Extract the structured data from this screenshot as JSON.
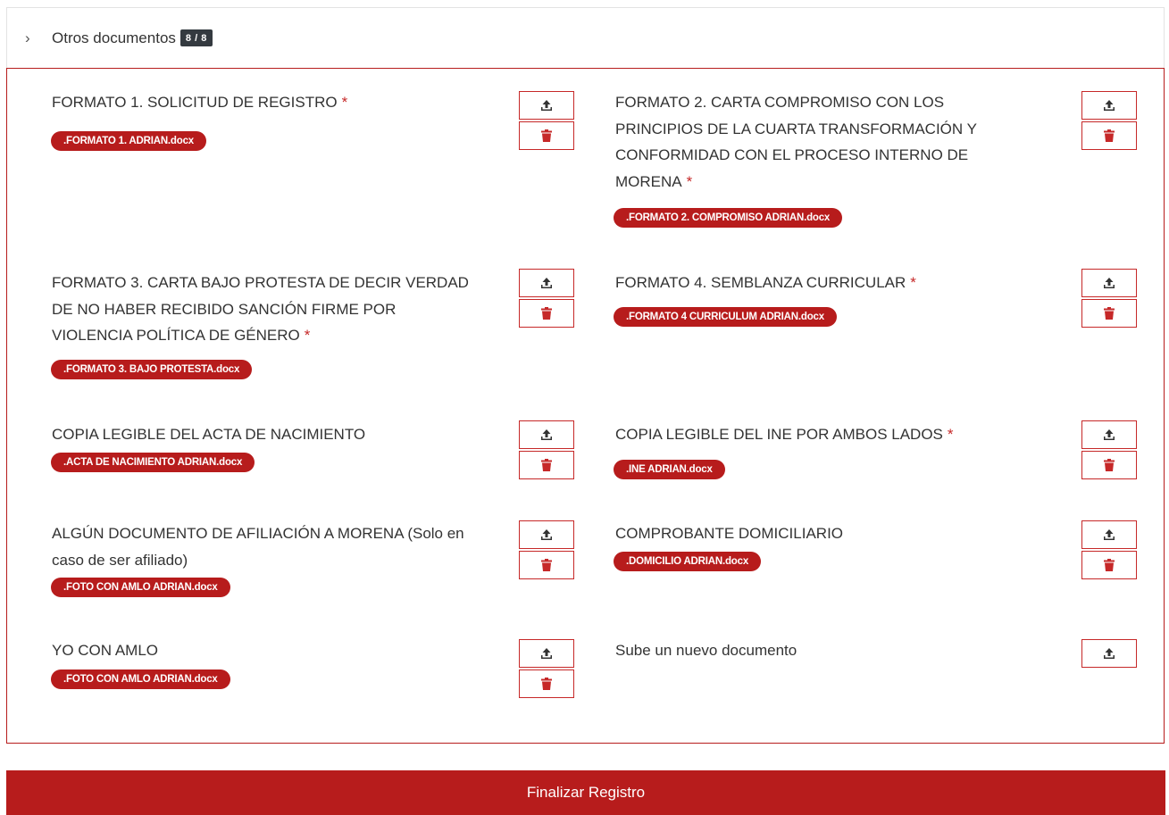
{
  "panel": {
    "chevron": "›",
    "title": "Otros documentos",
    "count": "8 / 8"
  },
  "documents": [
    {
      "title": "FORMATO 1. SOLICITUD DE REGISTRO",
      "required": "*",
      "file": ".FORMATO 1. ADRIAN.docx"
    },
    {
      "title": "FORMATO 2. CARTA COMPROMISO CON LOS PRINCIPIOS DE LA CUARTA TRANSFORMACIÓN Y CONFORMIDAD CON EL PROCESO INTERNO DE MORENA",
      "required": "*",
      "file": ".FORMATO 2. COMPROMISO ADRIAN.docx"
    },
    {
      "title": "FORMATO 3. CARTA BAJO PROTESTA DE DECIR VERDAD DE NO HABER RECIBIDO SANCIÓN FIRME POR VIOLENCIA POLÍTICA DE GÉNERO",
      "required": "*",
      "file": ".FORMATO 3. BAJO PROTESTA.docx"
    },
    {
      "title": "FORMATO 4. SEMBLANZA CURRICULAR",
      "required": "*",
      "file": ".FORMATO 4 CURRICULUM ADRIAN.docx"
    },
    {
      "title": "COPIA LEGIBLE DEL ACTA DE NACIMIENTO",
      "required": "",
      "file": ".ACTA DE NACIMIENTO ADRIAN.docx"
    },
    {
      "title": "COPIA LEGIBLE DEL INE POR AMBOS LADOS",
      "required": "*",
      "file": ".INE ADRIAN.docx"
    },
    {
      "title": "ALGÚN DOCUMENTO DE AFILIACIÓN A MORENA (Solo en caso de ser afiliado)",
      "required": "",
      "file": ".FOTO CON AMLO ADRIAN.docx"
    },
    {
      "title": "COMPROBANTE DOMICILIARIO",
      "required": "",
      "file": ".DOMICILIO ADRIAN.docx"
    },
    {
      "title": "YO CON AMLO",
      "required": "",
      "file": ".FOTO CON AMLO ADRIAN.docx"
    }
  ],
  "new_document": {
    "title": "Sube un nuevo documento"
  },
  "icons": {
    "upload": "upload-icon",
    "delete": "trash-icon"
  },
  "colors": {
    "accent": "#b71c1c",
    "badge_bg": "#343a40",
    "text": "#333333"
  },
  "finalize_label": "Finalizar Registro"
}
